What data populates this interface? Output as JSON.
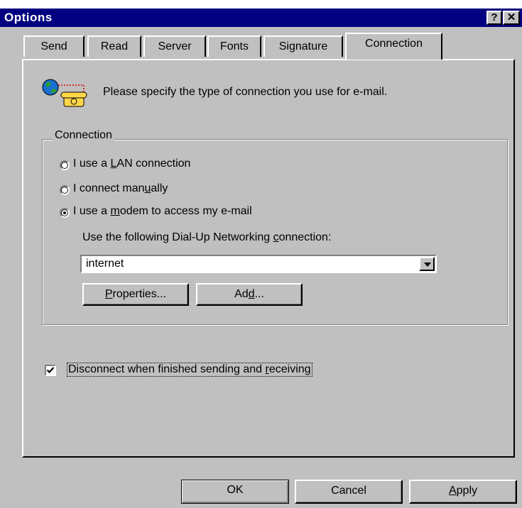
{
  "window": {
    "title": "Options",
    "help_button": "?",
    "close_button": "✕"
  },
  "tabs": [
    {
      "label": "Send",
      "active": false
    },
    {
      "label": "Read",
      "active": false
    },
    {
      "label": "Server",
      "active": false
    },
    {
      "label": "Fonts",
      "active": false
    },
    {
      "label": "Signature",
      "active": false
    },
    {
      "label": "Connection",
      "active": true
    }
  ],
  "intro_text": "Please specify the type of connection you use for e-mail.",
  "connection_group": {
    "label": "Connection",
    "options": [
      {
        "pre": "I use a ",
        "mnemonic": "L",
        "post": "AN connection",
        "selected": false
      },
      {
        "pre": "I connect man",
        "mnemonic": "u",
        "post": "ally",
        "selected": false
      },
      {
        "pre": "I use a ",
        "mnemonic": "m",
        "post": "odem to access my e-mail",
        "selected": true
      }
    ],
    "dialup_label_pre": "Use the following Dial-Up Networking ",
    "dialup_label_mnemonic": "c",
    "dialup_label_post": "onnection:",
    "dialup_value": "internet",
    "properties_pre": "",
    "properties_mnemonic": "P",
    "properties_post": "roperties...",
    "add_pre": "Ad",
    "add_mnemonic": "d",
    "add_post": "..."
  },
  "disconnect": {
    "checked": true,
    "pre": "Disconnect when finished sending and ",
    "mnemonic": "r",
    "post": "eceiving"
  },
  "footer": {
    "ok": "OK",
    "cancel": "Cancel",
    "apply_mnemonic": "A",
    "apply_post": "pply"
  }
}
